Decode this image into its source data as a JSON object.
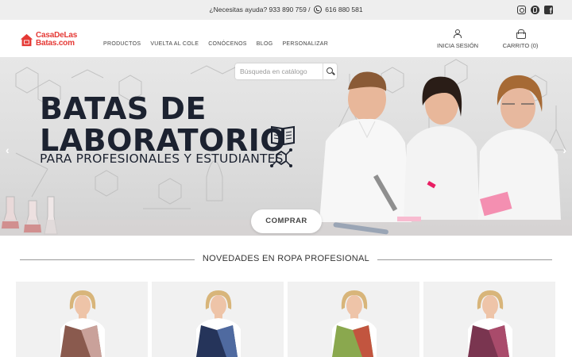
{
  "topbar": {
    "help_text": "¿Necesitas ayuda? 933 890 759 /",
    "whatsapp_number": "616 880 581",
    "social": [
      "instagram-icon",
      "pinterest-icon",
      "facebook-icon"
    ]
  },
  "header": {
    "logo_line1": "CasaDeLas",
    "logo_line2": "Batas.com",
    "nav": [
      "PRODUCTOS",
      "VUELTA AL COLE",
      "CONÓCENOS",
      "BLOG",
      "PERSONALIZAR"
    ],
    "account_label": "INICIA SESIÓN",
    "cart_label": "CARRITO (0)"
  },
  "search": {
    "placeholder": "Búsqueda en catálogo"
  },
  "hero": {
    "title_line1": "BATAS DE",
    "title_line2": "LABORATORIO",
    "subtitle": "PARA PROFESIONALES Y ESTUDIANTES",
    "cta": "COMPRAR",
    "prev_arrow": "‹",
    "next_arrow": "›"
  },
  "section": {
    "title": "NOVEDADES EN ROPA PROFESIONAL"
  },
  "products": [
    {
      "color": "#8a5a4e",
      "accent": "#c9a19a"
    },
    {
      "color": "#25345a",
      "accent": "#4f6aa0"
    },
    {
      "color": "#8aa84e",
      "accent": "#c2553f"
    },
    {
      "color": "#7a3550",
      "accent": "#a94b6b"
    }
  ],
  "colors": {
    "brand": "#e53935",
    "text_dark": "#1c2230"
  }
}
